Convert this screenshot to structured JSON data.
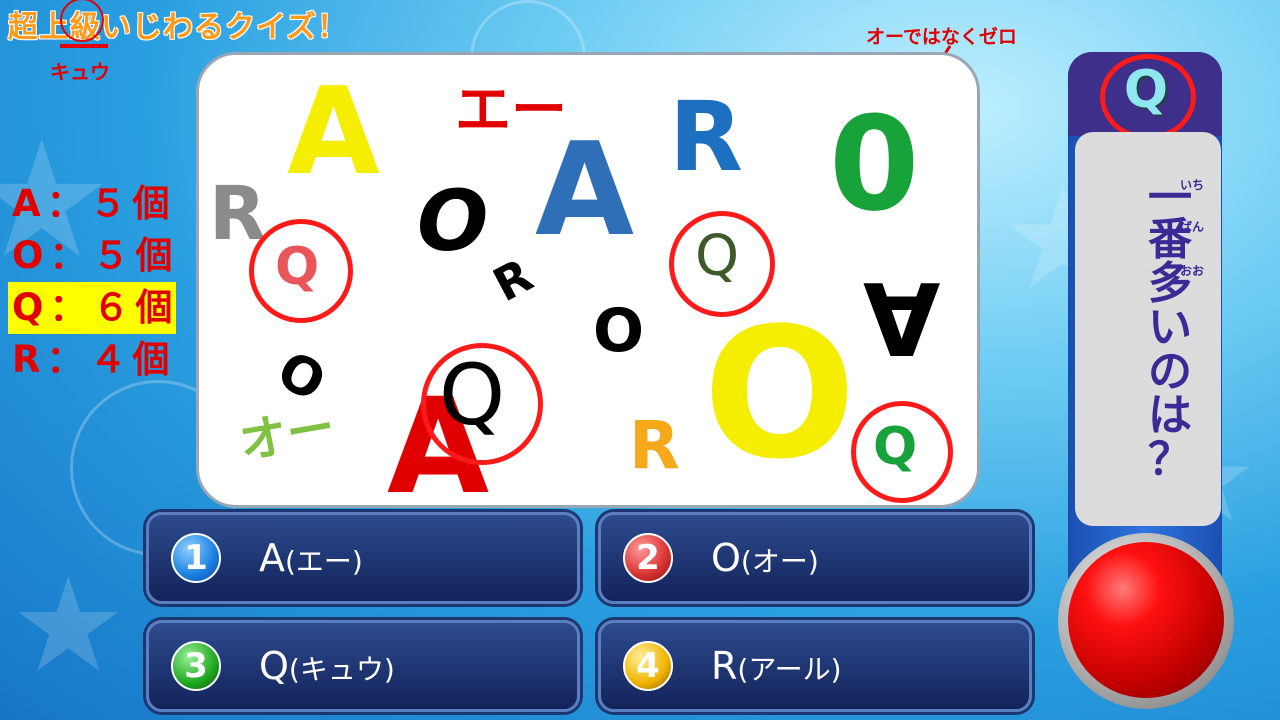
{
  "title": "超上級いじわるクイズ！",
  "kyu_reading": "キュウ",
  "zero_note": "オーではなくゼロ",
  "counts": [
    {
      "letter": "A",
      "text": "A：５個",
      "highlight": false
    },
    {
      "letter": "O",
      "text": "O：５個",
      "highlight": false
    },
    {
      "letter": "Q",
      "text": "Q：６個",
      "highlight": true
    },
    {
      "letter": "R",
      "text": "R：４個",
      "highlight": false
    }
  ],
  "board_letters": [
    {
      "id": "A-yellow",
      "text": "A",
      "color": "#f6ee00"
    },
    {
      "id": "katakana-e",
      "text": "エー",
      "color": "#e00000"
    },
    {
      "id": "A-blue",
      "text": "A",
      "color": "#2f6fb8"
    },
    {
      "id": "R-blue",
      "text": "R",
      "color": "#1d6fc0"
    },
    {
      "id": "zero-green",
      "text": "0",
      "color": "#18a23a"
    },
    {
      "id": "R-gray",
      "text": "R",
      "color": "#8b8b8b"
    },
    {
      "id": "O-italic-black",
      "text": "O",
      "color": "#000000"
    },
    {
      "id": "Q-pink",
      "text": "Q",
      "color": "#e8565a"
    },
    {
      "id": "Q-olive",
      "text": "Q",
      "color": "#3e5a2a"
    },
    {
      "id": "R-rotated-black",
      "text": "R",
      "color": "#000000"
    },
    {
      "id": "O-black-small",
      "text": "O",
      "color": "#000000"
    },
    {
      "id": "A-upside-down",
      "text": "A",
      "color": "#000000"
    },
    {
      "id": "O-yellow-big",
      "text": "O",
      "color": "#f6ee00"
    },
    {
      "id": "O-tilted-black",
      "text": "O",
      "color": "#000000"
    },
    {
      "id": "katakana-o",
      "text": "オー",
      "color": "#7fc241"
    },
    {
      "id": "A-red-big",
      "text": "A",
      "color": "#e00000"
    },
    {
      "id": "Q-black-big",
      "text": "Q",
      "color": "#000000"
    },
    {
      "id": "R-orange",
      "text": "R",
      "color": "#f5a91a"
    },
    {
      "id": "Q-green",
      "text": "Q",
      "color": "#18a23a"
    }
  ],
  "options": [
    {
      "num": "1",
      "letter": "A",
      "reading": "(エー)",
      "color": "#1b7fe0"
    },
    {
      "num": "2",
      "letter": "O",
      "reading": "(オー)",
      "color": "#d83232"
    },
    {
      "num": "3",
      "letter": "Q",
      "reading": "(キュウ)",
      "color": "#1fa81f"
    },
    {
      "num": "4",
      "letter": "R",
      "reading": "(アール)",
      "color": "#f0b400"
    }
  ],
  "side": {
    "badge": "Q",
    "question_chars": [
      "一",
      "番",
      "多",
      "い",
      "の",
      "は",
      "？"
    ],
    "furigana": [
      "いち",
      "ばん",
      "おお"
    ]
  }
}
